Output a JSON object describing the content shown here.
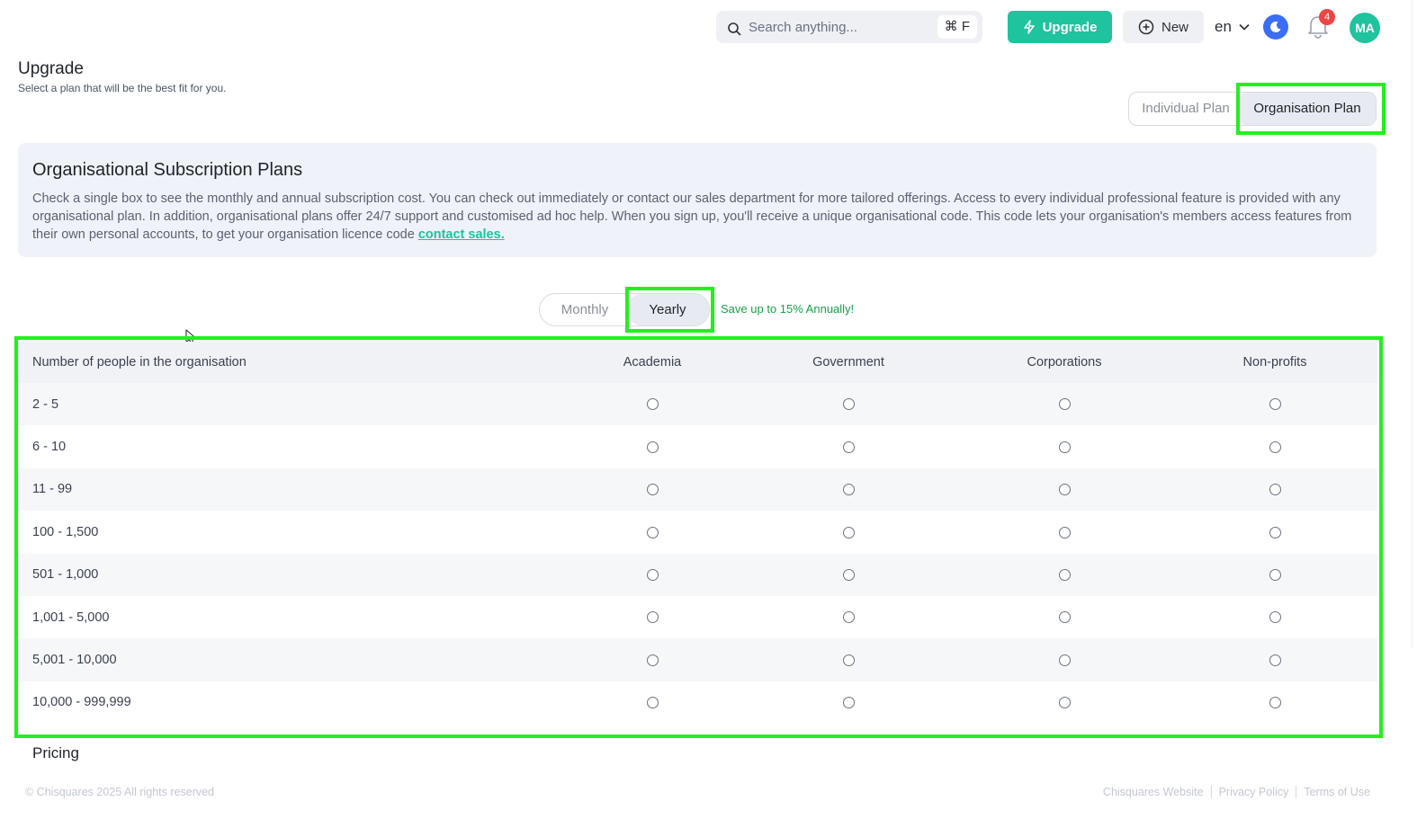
{
  "topbar": {
    "search_placeholder": "Search anything...",
    "search_shortcut": "⌘ F",
    "upgrade_label": "Upgrade",
    "new_label": "New",
    "language": "en",
    "notification_count": "4",
    "avatar_initials": "MA",
    "colors": {
      "accent": "#1fc39e",
      "theme_toggle": "#3b6ef5",
      "badge": "#ef4444"
    }
  },
  "page": {
    "title": "Upgrade",
    "subtitle": "Select a plan that will be the best fit for you."
  },
  "plan_tabs": [
    {
      "label": "Individual Plan",
      "active": false
    },
    {
      "label": "Organisation Plan",
      "active": true
    }
  ],
  "info": {
    "title": "Organisational Subscription Plans",
    "body": "Check a single box to see the monthly and annual subscription cost. You can check out immediately or contact our sales department for more tailored offerings. Access to every individual professional feature is provided with any organisational plan. In addition, organisational plans offer 24/7 support and customised ad hoc help. When you sign up, you'll receive a unique organisational code. This code lets your organisation's members access features from their own personal accounts, to get your organisation licence code ",
    "link": "contact sales."
  },
  "billing": {
    "monthly": "Monthly",
    "yearly": "Yearly",
    "selected": "Yearly",
    "note": "Save up to 15% Annually!"
  },
  "table": {
    "headers": [
      "Number of people in the organisation",
      "Academia",
      "Government",
      "Corporations",
      "Non-profits"
    ],
    "rows": [
      "2 - 5",
      "6 - 10",
      "11 - 99",
      "100 - 1,500",
      "501 - 1,000",
      "1,001 - 5,000",
      "5,001 - 10,000",
      "10,000 - 999,999"
    ]
  },
  "pricing_label": "Pricing",
  "footer": {
    "copyright": "© Chisquares 2025 All rights reserved",
    "links": [
      "Chisquares Website",
      "Privacy Policy",
      "Terms of Use"
    ]
  }
}
